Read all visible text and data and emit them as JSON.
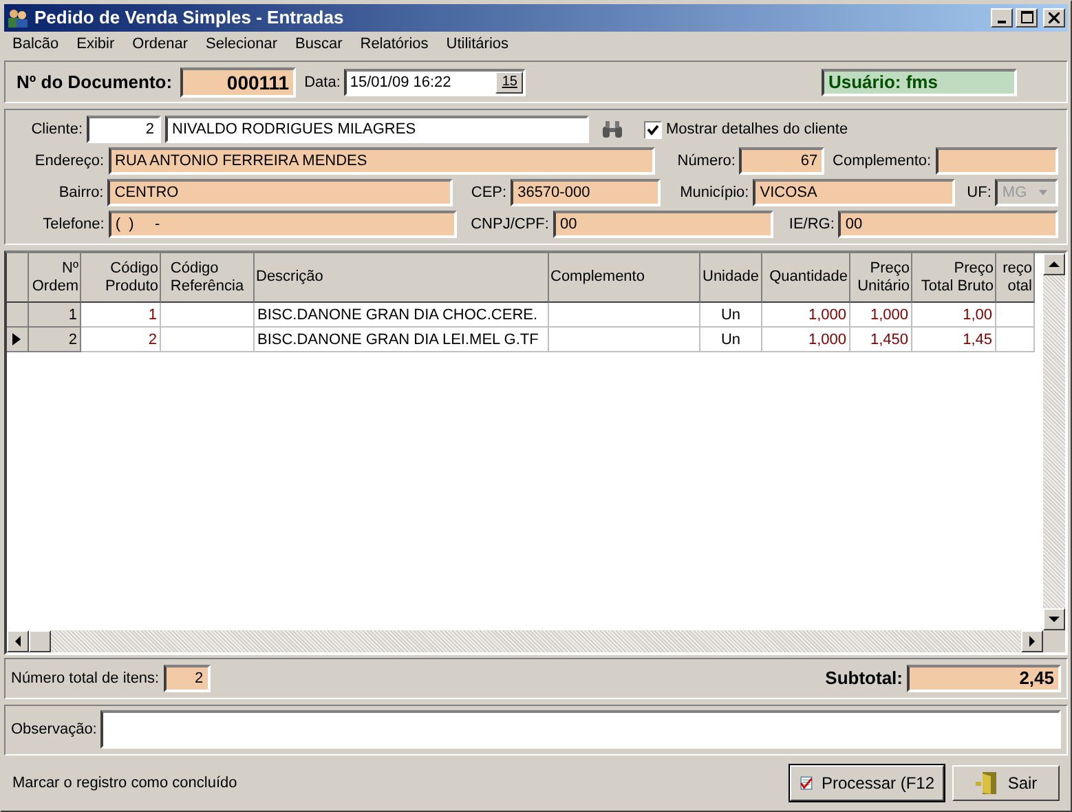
{
  "window": {
    "title": "Pedido de Venda Simples - Entradas"
  },
  "menu": [
    "Balcão",
    "Exibir",
    "Ordenar",
    "Selecionar",
    "Buscar",
    "Relatórios",
    "Utilitários"
  ],
  "document": {
    "label": "Nº do Documento:",
    "number": "000111",
    "date_label": "Data:",
    "date": "15/01/09 16:22",
    "calendar_button": "15",
    "user": "Usuário: fms"
  },
  "client": {
    "label": "Cliente:",
    "code": "2",
    "name": "NIVALDO RODRIGUES MILAGRES",
    "show_details": {
      "label": "Mostrar detalhes do cliente",
      "checked": true
    },
    "address_label": "Endereço:",
    "address": "RUA ANTONIO FERREIRA MENDES",
    "number_label": "Número:",
    "number": "67",
    "complement_label": "Complemento:",
    "district_label": "Bairro:",
    "district": "CENTRO",
    "cep_label": "CEP:",
    "cep": "36570-000",
    "city_label": "Município:",
    "city": "VICOSA",
    "uf_label": "UF:",
    "uf": "MG",
    "phone_label": "Telefone:",
    "phone": "(  )     -",
    "doc_label": "CNPJ/CPF:",
    "doc": "00",
    "ie_label": "IE/RG:",
    "ie": "00"
  },
  "table": {
    "columns": [
      {
        "lines": [
          "Nº",
          "Ordem"
        ],
        "kind": "index"
      },
      {
        "lines": [
          "Código",
          "Produto"
        ],
        "kind": "code"
      },
      {
        "lines": [
          "Código",
          "Referência"
        ],
        "kind": "text"
      },
      {
        "lines": [
          "Descrição"
        ],
        "kind": "text"
      },
      {
        "lines": [
          "Complemento"
        ],
        "kind": "text"
      },
      {
        "lines": [
          "Unidade"
        ],
        "kind": "unit"
      },
      {
        "lines": [
          "Quantidade"
        ],
        "kind": "amount"
      },
      {
        "lines": [
          "Preço",
          "Unitário"
        ],
        "kind": "amount"
      },
      {
        "lines": [
          "Preço",
          "Total Bruto"
        ],
        "kind": "amount"
      },
      {
        "lines": [
          "reço",
          "otal"
        ],
        "kind": "amount"
      }
    ],
    "rows": [
      {
        "current": false,
        "cells": [
          "1",
          "1",
          "",
          "BISC.DANONE GRAN DIA CHOC.CERE.",
          "",
          "Un",
          "1,000",
          "1,000",
          "1,00",
          ""
        ]
      },
      {
        "current": true,
        "cells": [
          "2",
          "2",
          "",
          "BISC.DANONE GRAN DIA LEI.MEL G.TF",
          "",
          "Un",
          "1,000",
          "1,450",
          "1,45",
          ""
        ]
      }
    ]
  },
  "totals": {
    "items_label": "Número total de itens:",
    "items": "2",
    "subtotal_label": "Subtotal:",
    "subtotal": "2,45"
  },
  "observation": {
    "label": "Observação:"
  },
  "status": "Marcar o registro como concluído",
  "buttons": [
    {
      "label": "Processar (F12",
      "kind": "process"
    },
    {
      "label": "Sair",
      "kind": "exit"
    }
  ]
}
